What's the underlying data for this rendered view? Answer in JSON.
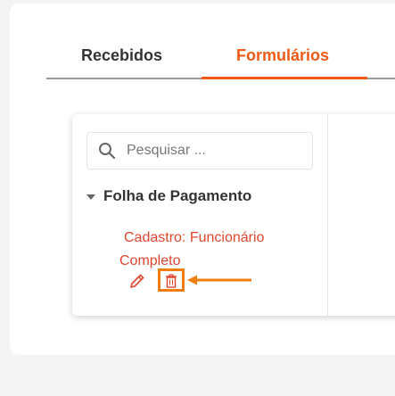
{
  "tabs": [
    {
      "label": "Recebidos",
      "active": false
    },
    {
      "label": "Formulários",
      "active": true
    }
  ],
  "colors": {
    "accent": "#ef5a16",
    "link": "#e1452c",
    "highlight": "#f07d10"
  },
  "search": {
    "placeholder": "Pesquisar ..."
  },
  "group": {
    "title": "Folha de Pagamento",
    "expanded": true
  },
  "form": {
    "title_line1": "Cadastro: Funcionário",
    "title_line2": "Completo"
  },
  "icons": {
    "search": "search-icon",
    "caret": "caret-down-icon",
    "edit": "pencil-icon",
    "delete": "trash-icon",
    "arrow": "arrow-left-icon"
  }
}
